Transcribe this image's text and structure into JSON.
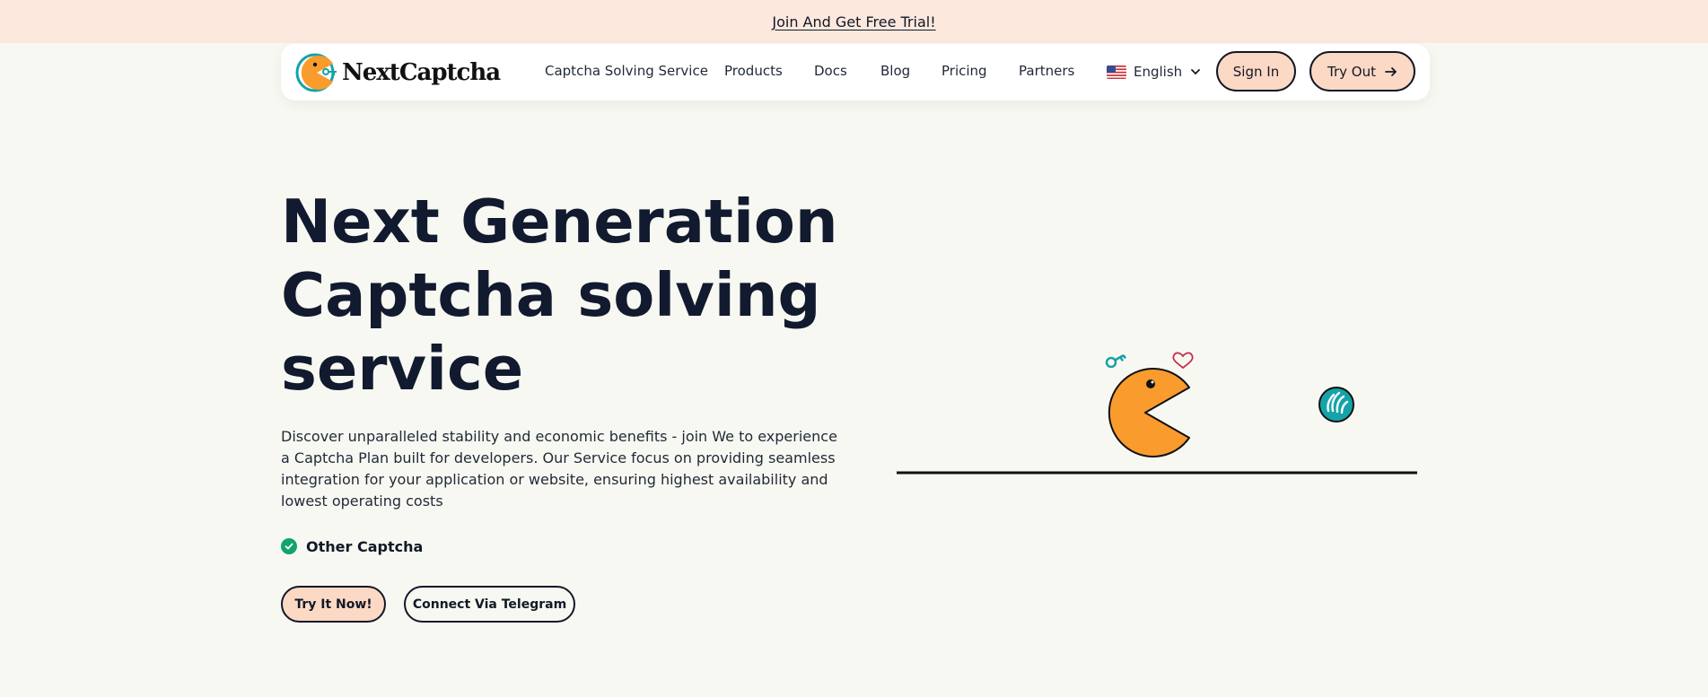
{
  "banner": {
    "text": "Join And Get Free Trial!"
  },
  "brand": {
    "name": "NextCaptcha"
  },
  "nav": {
    "items": [
      "Captcha Solving Service",
      "Products",
      "Docs",
      "Blog",
      "Pricing",
      "Partners"
    ],
    "language": "English",
    "sign_in": "Sign In",
    "try_out": "Try Out"
  },
  "hero": {
    "title_lines": [
      "Next Generation",
      "Captcha solving",
      "service"
    ],
    "description": "Discover unparalleled stability and economic benefits - join We to experience a Captcha Plan built for developers. Our Service focus on providing seamless integration for your application or website, ensuring highest availability and lowest operating costs",
    "feature": "Other Captcha",
    "cta_primary": "Try It Now!",
    "cta_secondary": "Connect Via Telegram"
  },
  "icons": {
    "logo": "pacman-key-logo-icon",
    "flag": "us-flag-icon",
    "chevron": "chevron-down-icon",
    "arrow": "arrow-right-icon",
    "check": "check-circle-icon",
    "heart": "heart-icon",
    "wave": "waving-hand-icon"
  },
  "colors": {
    "banner_bg": "#fde8de",
    "page_bg": "#f8f8f2",
    "button_peach": "#fcd9c4",
    "pacman_orange": "#f99b2d",
    "check_green": "#12a36f",
    "wave_teal": "#14a3a8",
    "heading": "#111a2e"
  }
}
